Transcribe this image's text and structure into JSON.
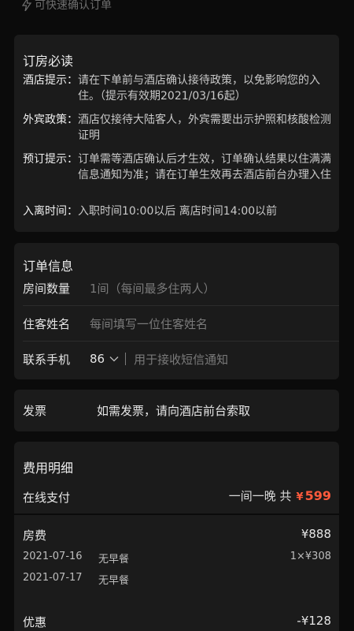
{
  "top_hint": "可快速确认订单",
  "reading": {
    "title": "订房必读",
    "items": [
      {
        "label": "酒店提示：",
        "text": "请在下单前与酒店确认接待政策，以免影响您的入住。（提示有效期2021/03/16起）"
      },
      {
        "label": "外宾政策：",
        "text": "酒店仅接待大陆客人，外宾需要出示护照和核酸检测证明"
      },
      {
        "label": "预订提示：",
        "text": "订单需等酒店确认后才生效，订单确认结果以住满满信息通知为准；请在订单生效再去酒店前台办理入住"
      },
      {
        "label": "入离时间：",
        "text": "入职时间10:00以后  离店时间14:00以前"
      }
    ]
  },
  "order": {
    "title": "订单信息",
    "rooms_label": "房间数量",
    "rooms_value": "1间（每间最多住两人）",
    "guest_label": "住客姓名",
    "guest_placeholder": "每间填写一位住客姓名",
    "phone_label": "联系手机",
    "phone_code": "86",
    "phone_placeholder": "用于接收短信通知"
  },
  "invoice": {
    "label": "发票",
    "text": "如需发票，请向酒店前台索取"
  },
  "fee": {
    "title": "费用明细",
    "pay_label": "在线支付",
    "pay_desc": "一间一晚 共",
    "currency": "¥",
    "total": "599",
    "room_fee_label": "房费",
    "room_fee_value": "¥888",
    "days": [
      {
        "date": "2021-07-16",
        "breakfast": "无早餐",
        "price": "1×¥308"
      },
      {
        "date": "2021-07-17",
        "breakfast": "无早餐",
        "price": ""
      }
    ],
    "discount_label": "优惠",
    "discount_value": "-¥128"
  },
  "colors": {
    "background": "#0b0b0b",
    "card": "#1b1b1b",
    "accent_price": "#ff5a3c",
    "muted_text": "#7a7a7a"
  }
}
